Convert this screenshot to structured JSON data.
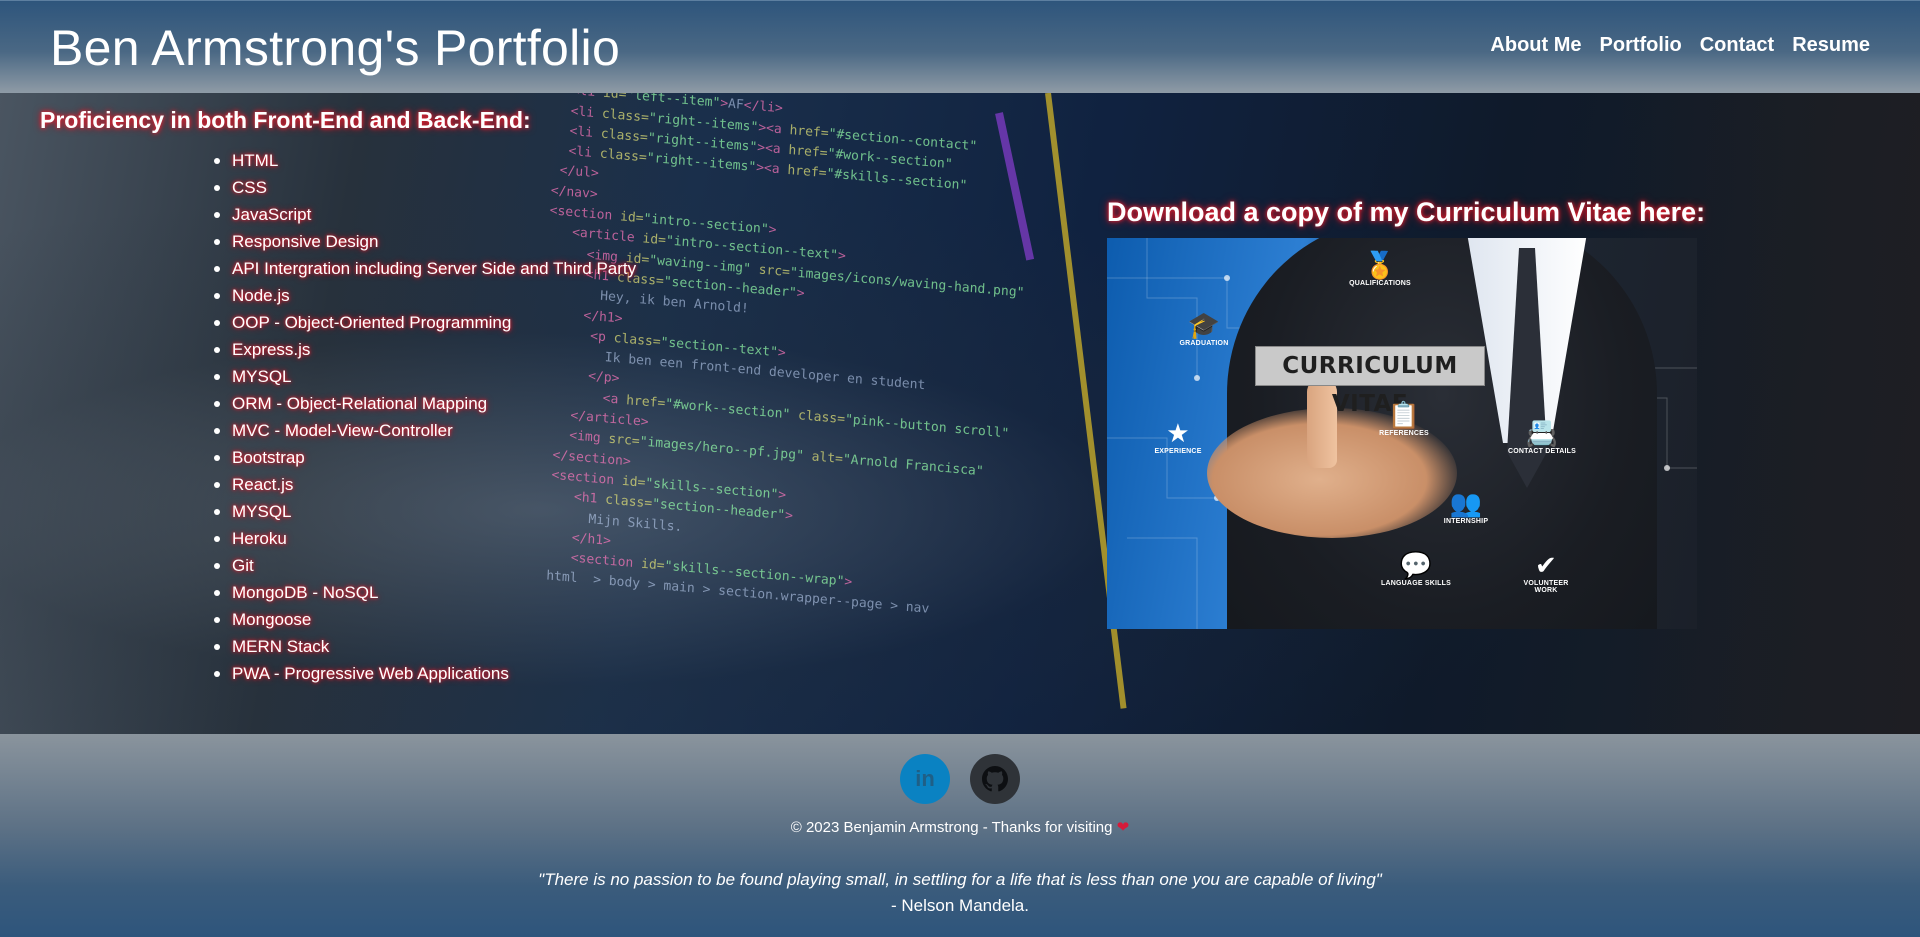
{
  "header": {
    "title": "Ben Armstrong's Portfolio",
    "nav": [
      "About Me",
      "Portfolio",
      "Contact",
      "Resume"
    ]
  },
  "skills": {
    "heading": "Proficiency in both Front-End and Back-End:",
    "items": [
      "HTML",
      "CSS",
      "JavaScript",
      "Responsive Design",
      "API Intergration including Server Side and Third Party",
      "Node.js",
      "OOP - Object-Oriented Programming",
      "Express.js",
      "MYSQL",
      "ORM - Object-Relational Mapping",
      "MVC - Model-View-Controller",
      "Bootstrap",
      "React.js",
      "MYSQL",
      "Heroku",
      "Git",
      "MongoDB - NoSQL",
      "Mongoose",
      "MERN Stack",
      "PWA - Progressive Web Applications"
    ]
  },
  "resume": {
    "heading": "Download a copy of my Curriculum Vitae here:",
    "image_label": "CURRICULUM VITAE",
    "image_icons": [
      "QUALIFICATIONS",
      "GRADUATION",
      "EXPERIENCE",
      "REFERENCES",
      "CONTACT DETAILS",
      "INTERNSHIP",
      "LANGUAGE SKILLS",
      "VOLUNTEER WORK"
    ]
  },
  "footer": {
    "social": [
      {
        "name": "linkedin-icon",
        "glyph": "in",
        "color": "#0a82c2"
      },
      {
        "name": "github-icon",
        "color": "#2f3338"
      }
    ],
    "copyright": "© 2023 Benjamin Armstrong - Thanks for visiting",
    "heart": "❤",
    "quote": "\"There is no passion to be found playing small, in settling for a life that is less than one you are capable of living\"",
    "quote_author": "- Nelson Mandela."
  },
  "colors": {
    "header_top": "#2e557c",
    "glow": "#ff2233",
    "linkedin": "#0a82c2"
  }
}
